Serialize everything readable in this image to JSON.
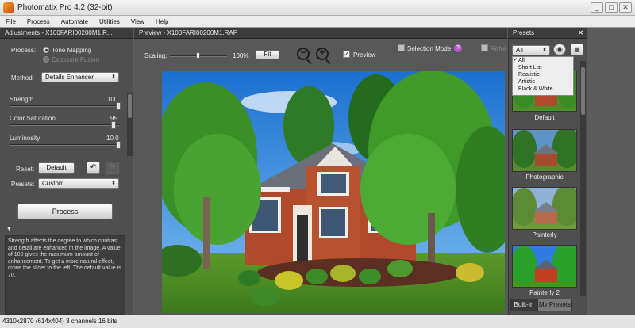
{
  "window": {
    "title": "Photomatix Pro 4.2 (32-bit)"
  },
  "menu": [
    "File",
    "Process",
    "Automate",
    "Utilities",
    "View",
    "Help"
  ],
  "adjustments": {
    "header": "Adjustments - X100FARI00200M1.R...",
    "process_label": "Process:",
    "process_options": [
      "Tone Mapping",
      "Exposure Fusion"
    ],
    "process_selected": "Tone Mapping",
    "method_label": "Method:",
    "method_value": "Details Enhancer",
    "sliders": [
      {
        "label": "Strength",
        "value": "100",
        "fraction": 1.0
      },
      {
        "label": "Color Saturation",
        "value": "95",
        "fraction": 0.95
      },
      {
        "label": "Luminosity",
        "value": "10.0",
        "fraction": 1.0
      }
    ],
    "reset_label": "Reset:",
    "default_button": "Default",
    "presets_label": "Presets:",
    "presets_value": "Custom",
    "process_button": "Process",
    "description": "Strength affects the degree to which contrast and detail are enhanced in the image. A value of 100 gives the maximum amount of enhancement. To get a more natural effect, move the slider to the left. The default value is 70."
  },
  "preview": {
    "header": "Preview - X100FARI00200M1.RAF",
    "scaling_label": "Scaling:",
    "scaling_value": "100%",
    "scaling_fraction": 0.5,
    "fit_button": "Fit",
    "preview_checkbox": "Preview",
    "selection_mode": "Selection Mode",
    "refresh": "Refre"
  },
  "presets": {
    "header": "Presets",
    "filter_value": "All",
    "filter_options": [
      "All",
      "Short List",
      "Realistic",
      "Artistic",
      "Black & White"
    ],
    "items": [
      "Default",
      "Photographic",
      "Painterly",
      "Painterly 2"
    ],
    "tabs": [
      "Built-In",
      "My Presets"
    ]
  },
  "status": {
    "text": "4310x2870 (614x404) 3 channels 16 bits"
  },
  "icons": {
    "help": "?",
    "close": "✕",
    "undo": "↶",
    "redo": "↷"
  }
}
